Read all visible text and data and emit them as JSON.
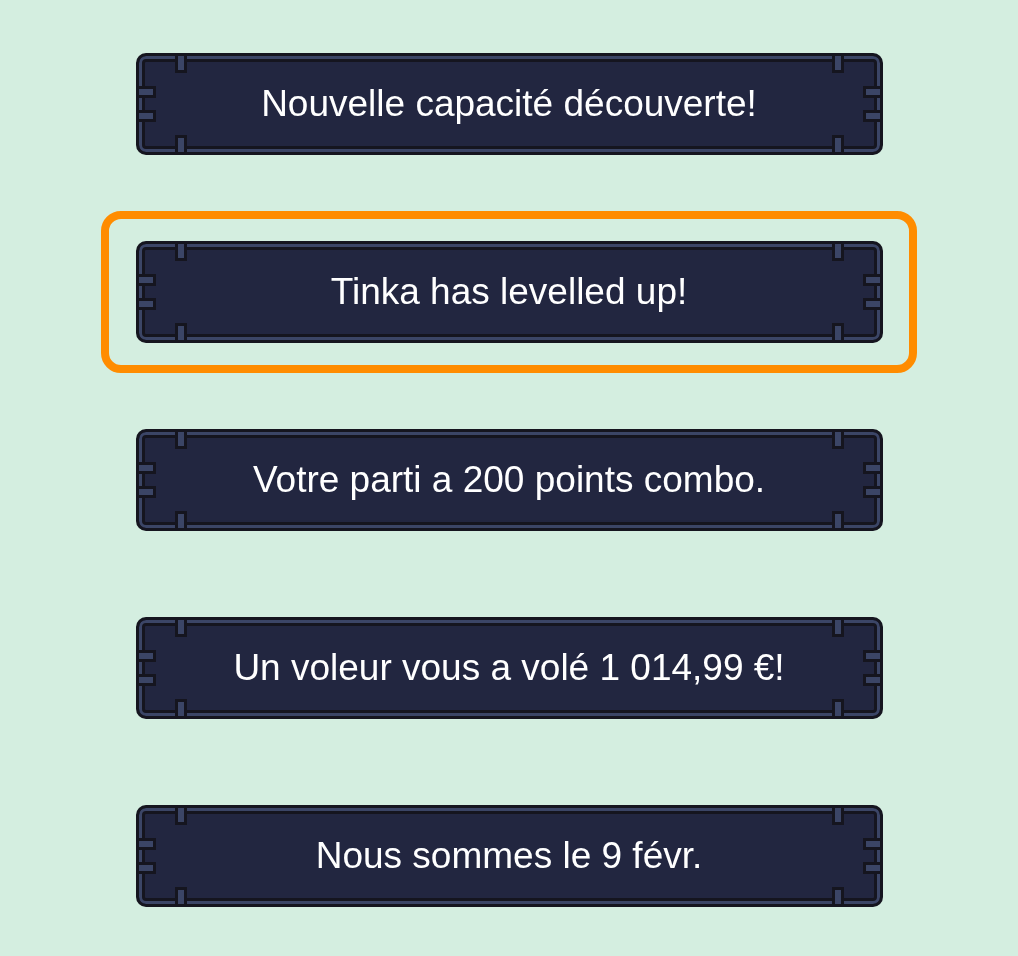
{
  "banners": [
    {
      "text": "Nouvelle capacité découverte!",
      "selected": false
    },
    {
      "text": "Tinka has levelled up!",
      "selected": true
    },
    {
      "text": "Votre parti a 200 points combo.",
      "selected": false
    },
    {
      "text": "Un voleur vous a volé 1 014,99 €!",
      "selected": false
    },
    {
      "text": "Nous sommes le 9 févr.",
      "selected": false
    }
  ]
}
